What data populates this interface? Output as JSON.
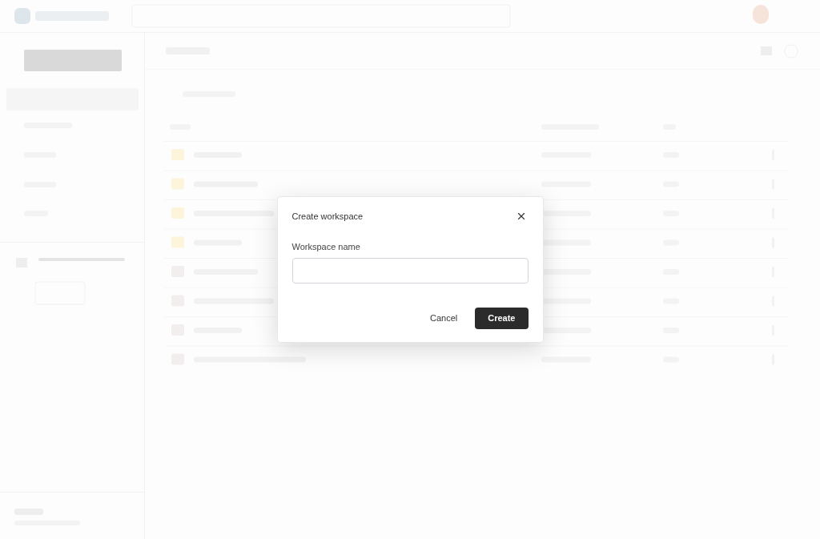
{
  "dialog": {
    "title": "Create workspace",
    "field": {
      "label": "Workspace name"
    },
    "buttons": [
      {
        "label": "Cancel",
        "kind": "secondary"
      },
      {
        "label": "Create",
        "kind": "primary"
      }
    ]
  }
}
